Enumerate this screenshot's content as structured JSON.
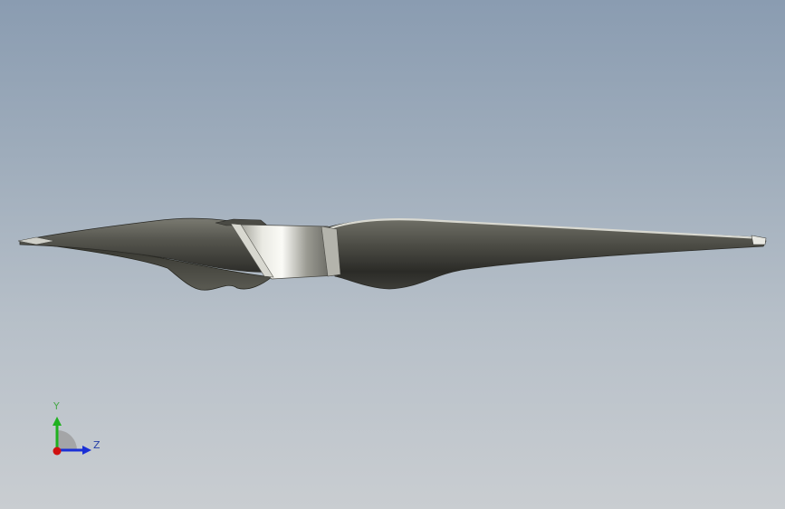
{
  "triad": {
    "y_label": "Y",
    "z_label": "Z",
    "x_color": "#d01010",
    "y_color": "#1fb11f",
    "z_color": "#1a2fd6"
  },
  "model": {
    "icon": "propeller-blade-model"
  }
}
